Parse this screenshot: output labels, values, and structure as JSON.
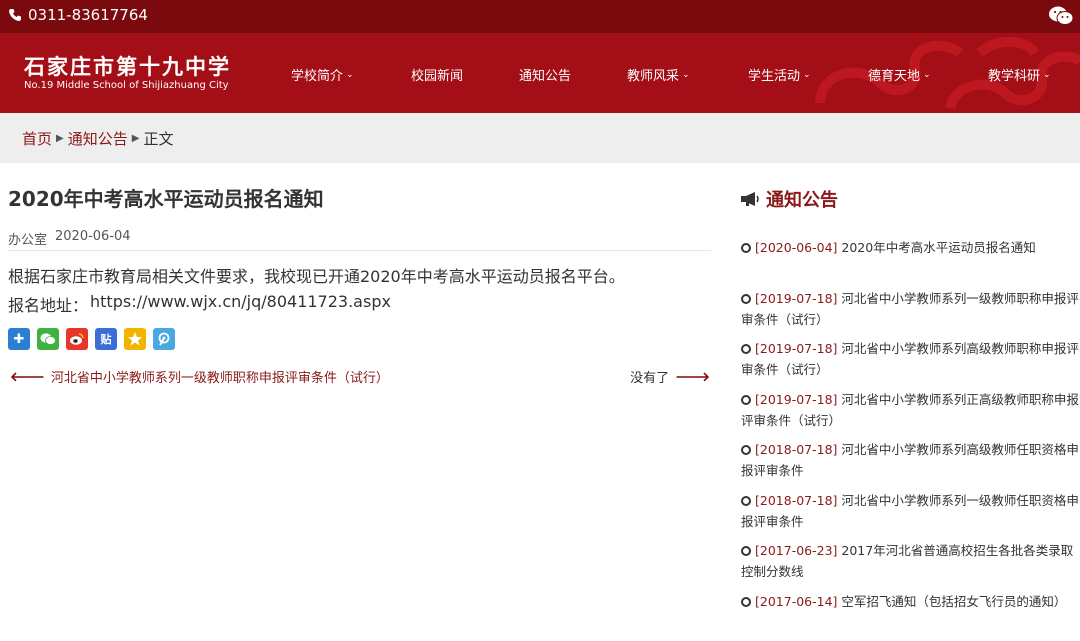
{
  "topbar": {
    "phone": "0311-83617764"
  },
  "header": {
    "logo_cn": "石家庄市第十九中学",
    "logo_en": "No.19 Middle School of Shijiazhuang City",
    "menu": [
      "学校简介",
      "校园新闻",
      "通知公告",
      "教师风采",
      "学生活动",
      "德育天地",
      "教学科研"
    ]
  },
  "breadcrumb": {
    "home": "首页",
    "section": "通知公告",
    "current": "正文"
  },
  "article": {
    "title": "2020年中考高水平运动员报名通知",
    "author": "办公室",
    "date": "2020-06-04",
    "paragraph1": "根据石家庄市教育局相关文件要求，我校现已开通2020年中考高水平运动员报名平台。",
    "address_label": "报名地址：",
    "address_url": "https://www.wjx.cn/jq/80411723.aspx"
  },
  "pager": {
    "prev": "河北省中小学教师系列一级教师职称申报评审条件（试行）",
    "next": "没有了"
  },
  "sidebar": {
    "title": "通知公告",
    "items": [
      {
        "date": "[2020-06-04]",
        "text": " 2020年中考高水平运动员报名通知"
      },
      {
        "date": "[2019-07-18]",
        "text": " 河北省中小学教师系列一级教师职称申报评审条件（试行）"
      },
      {
        "date": "[2019-07-18]",
        "text": " 河北省中小学教师系列高级教师职称申报评审条件（试行）"
      },
      {
        "date": "[2019-07-18]",
        "text": " 河北省中小学教师系列正高级教师职称申报评审条件（试行）"
      },
      {
        "date": "[2018-07-18]",
        "text": " 河北省中小学教师系列高级教师任职资格申报评审条件"
      },
      {
        "date": "[2018-07-18]",
        "text": " 河北省中小学教师系列一级教师任职资格申报评审条件"
      },
      {
        "date": "[2017-06-23]",
        "text": " 2017年河北省普通高校招生各批各类录取控制分数线"
      },
      {
        "date": "[2017-06-14]",
        "text": " 空军招飞通知（包括招女飞行员的通知）"
      }
    ]
  },
  "colors": {
    "topbar": "#7a0a0e",
    "nav": "#a40e16",
    "accent": "#8a1a1a"
  }
}
